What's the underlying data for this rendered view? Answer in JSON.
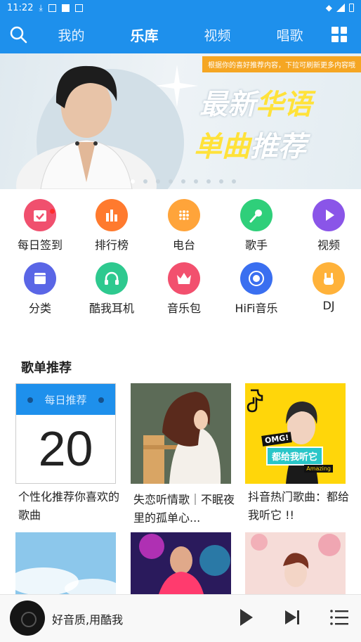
{
  "status": {
    "time": "11:22"
  },
  "nav": {
    "tabs": [
      "我的",
      "乐库",
      "视频",
      "唱歌"
    ],
    "active_index": 1
  },
  "banner": {
    "tip": "根据你的喜好推荐内容，下拉可刷新更多内容哦",
    "line1_a": "最新",
    "line1_b": "华语",
    "line2_a": "单曲",
    "line2_b": "推荐"
  },
  "shortcuts": [
    {
      "label": "每日签到",
      "color": "#f0506e",
      "icon": "calendar-check-icon",
      "badge": true
    },
    {
      "label": "排行榜",
      "color": "#ff7a2e",
      "icon": "bar-chart-icon"
    },
    {
      "label": "电台",
      "color": "#ffa43a",
      "icon": "radio-dots-icon"
    },
    {
      "label": "歌手",
      "color": "#2fcf7a",
      "icon": "microphone-icon"
    },
    {
      "label": "视频",
      "color": "#8a55e8",
      "icon": "play-icon"
    },
    {
      "label": "分类",
      "color": "#5a66e6",
      "icon": "category-icon"
    },
    {
      "label": "酷我耳机",
      "color": "#2ec98f",
      "icon": "headphones-icon"
    },
    {
      "label": "音乐包",
      "color": "#f2506e",
      "icon": "crown-icon"
    },
    {
      "label": "HiFi音乐",
      "color": "#3a6ff0",
      "icon": "hifi-disc-icon"
    },
    {
      "label": "DJ",
      "color": "#ffb23a",
      "icon": "rock-hand-icon"
    }
  ],
  "playlists": {
    "title": "歌单推荐",
    "daily_header": "每日推荐",
    "daily_number": "20",
    "items": [
      {
        "caption": "个性化推荐你喜欢的歌曲"
      },
      {
        "caption": "失恋听情歌｜不眠夜里的孤单心..."
      },
      {
        "caption": "抖音热门歌曲：都给我听它 !!"
      }
    ],
    "douyin_badge": "OMG!",
    "douyin_text": "都给我听它",
    "douyin_tag": "Amazing"
  },
  "player": {
    "title": "好音质,用酷我"
  }
}
